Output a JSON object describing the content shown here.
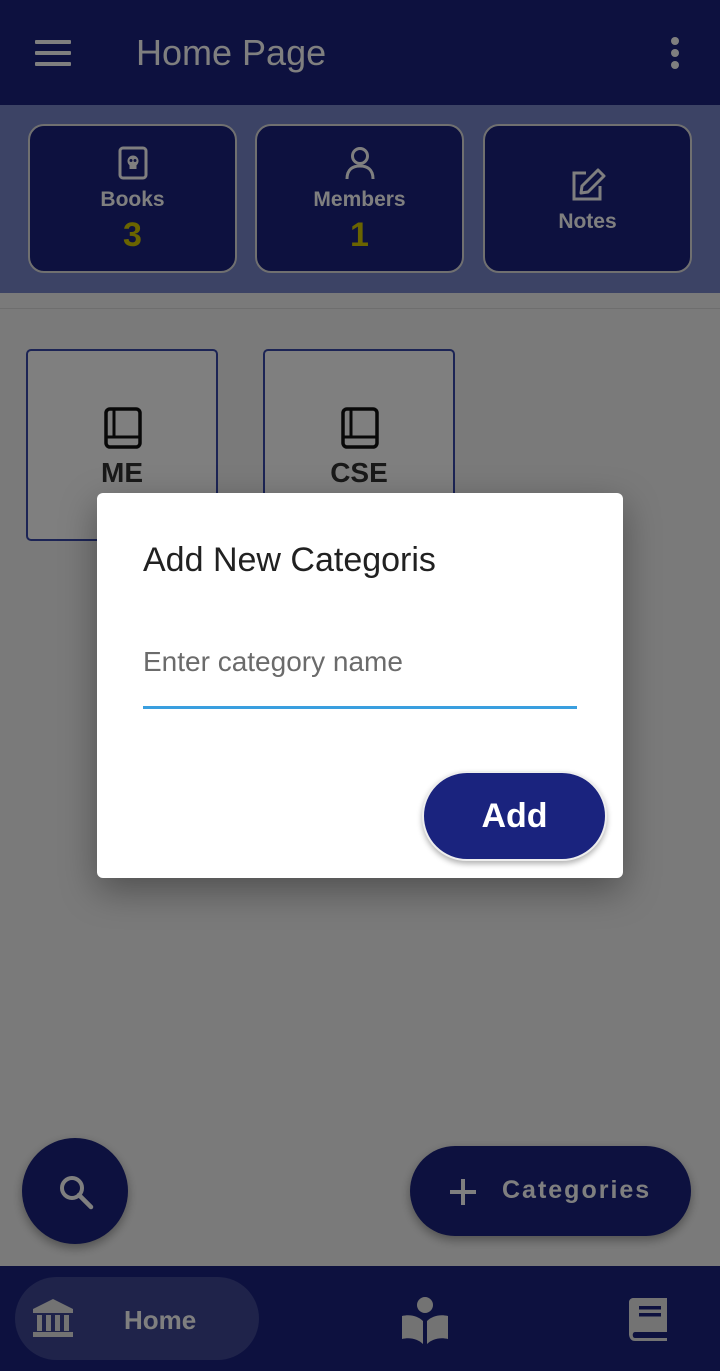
{
  "app_bar": {
    "title": "Home Page",
    "menu_icon": "hamburger-menu-icon",
    "overflow_icon": "more-vert-icon"
  },
  "stats": [
    {
      "label": "Books",
      "value": "3",
      "icon": "book-skull-icon"
    },
    {
      "label": "Members",
      "value": "1",
      "icon": "person-icon"
    },
    {
      "label": "Notes",
      "value": "",
      "icon": "edit-note-icon"
    }
  ],
  "categories": [
    {
      "label": "ME",
      "icon": "book-icon"
    },
    {
      "label": "CSE",
      "icon": "book-icon"
    }
  ],
  "fab": {
    "search_icon": "search-icon",
    "categories_label": "Categories",
    "categories_icon": "plus-icon"
  },
  "bottom_nav": {
    "home_label": "Home",
    "home_icon": "bank-icon",
    "reader_icon": "reading-person-icon",
    "book_icon": "book-icon"
  },
  "dialog": {
    "title": "Add New Categoris",
    "input_placeholder": "Enter category name",
    "input_value": "",
    "add_label": "Add"
  },
  "colors": {
    "primary": "#1a237e",
    "strip": "#7986cb",
    "accent_value": "#d4c800",
    "input_underline": "#3a9fdf"
  }
}
